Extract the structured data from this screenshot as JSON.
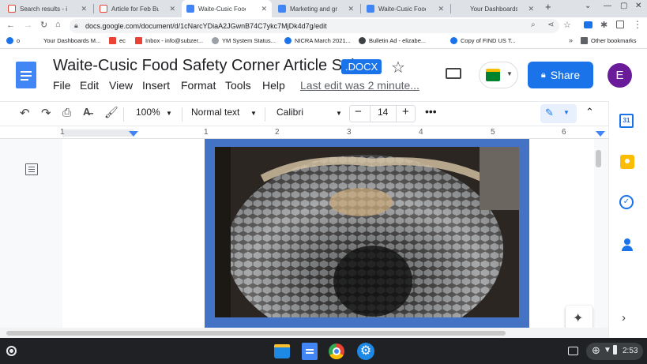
{
  "tabs": [
    {
      "title": "Search results - info@",
      "icon": "gmail-icon"
    },
    {
      "title": "Article for Feb Bulletin",
      "icon": "gmail-icon"
    },
    {
      "title": "Waite-Cusic Food Saf",
      "icon": "docs-icon",
      "active": true
    },
    {
      "title": "Marketing and growin",
      "icon": "docs-icon"
    },
    {
      "title": "Waite-Cusic Food Saf",
      "icon": "docs-icon"
    },
    {
      "title": "Your Dashboards Ad",
      "icon": "dashboard-icon"
    }
  ],
  "address": {
    "url": "docs.google.com/document/d/1cNarcYDiaA2JGwnB74C7ykc7MjDk4d7g/edit"
  },
  "bookmarks": [
    {
      "label": "o",
      "icon": "chrome-icon"
    },
    {
      "label": "Your Dashboards M...",
      "icon": "dashboard-icon"
    },
    {
      "label": "ec",
      "icon": "gmail-icon"
    },
    {
      "label": "Inbox - info@subzer...",
      "icon": "gmail-icon"
    },
    {
      "label": "YM System Status...",
      "icon": "status-icon"
    },
    {
      "label": "NICRA March 2021...",
      "icon": "chrome-icon"
    },
    {
      "label": "Bulletin Ad - elizabe...",
      "icon": "globe-icon"
    },
    {
      "label": "Copy of FIND US T...",
      "icon": "chrome-icon"
    }
  ],
  "bookmarks_more": "»",
  "other_bookmarks": "Other bookmarks",
  "doc": {
    "title": "Waite-Cusic Food Safety Corner Article Sub...",
    "badge": ".DOCX",
    "menus": [
      "File",
      "Edit",
      "View",
      "Insert",
      "Format",
      "Tools",
      "Help"
    ],
    "last_edit": "Last edit was 2 minute...",
    "share_label": "Share",
    "avatar_letter": "E"
  },
  "format_toolbar": {
    "zoom": "100%",
    "style": "Normal text",
    "font": "Calibri",
    "font_size": "14"
  },
  "ruler": {
    "numbers": [
      "1",
      "1",
      "2",
      "3",
      "4",
      "5",
      "6"
    ]
  },
  "side_panel": {
    "calendar_day": "31"
  },
  "shelf": {
    "time": "2:53"
  },
  "colors": {
    "accent": "#1a73e8",
    "frame": "#4472c4",
    "avatar": "#6a1b9a"
  }
}
